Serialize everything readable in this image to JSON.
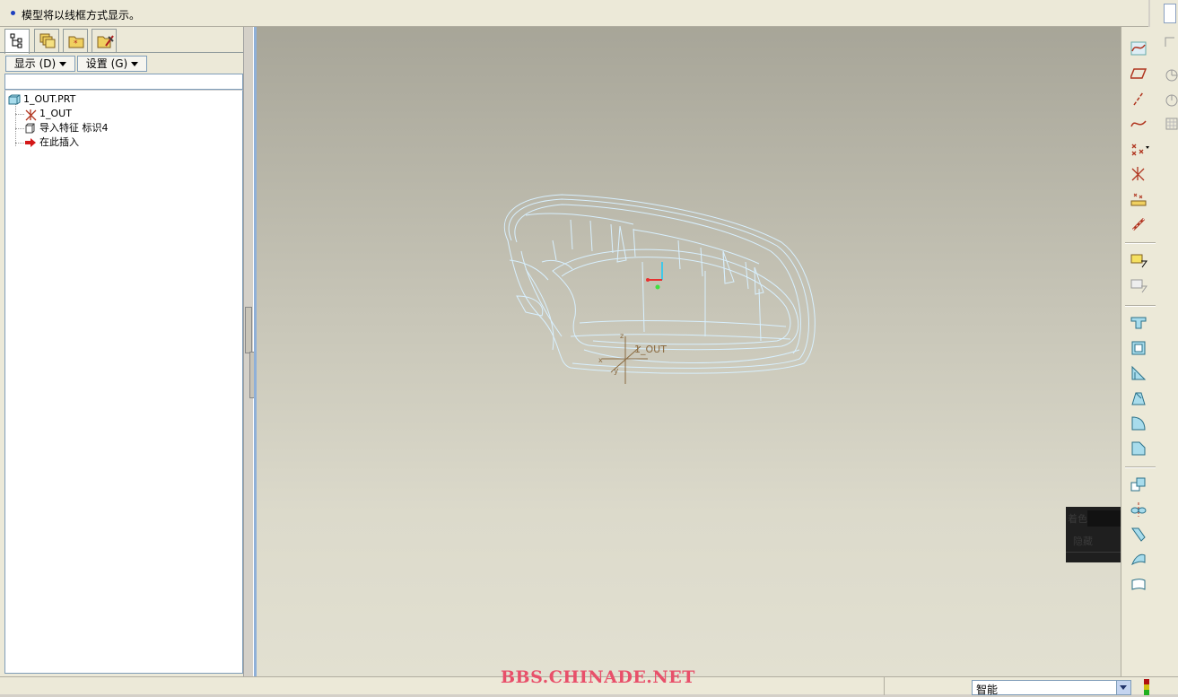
{
  "message": {
    "text": "模型将以线框方式显示。"
  },
  "left_panel": {
    "tabs": [
      {
        "icon": "model-tree-icon"
      },
      {
        "icon": "layers-icon"
      },
      {
        "icon": "favorites-folder-icon"
      },
      {
        "icon": "tools-icon"
      }
    ],
    "display_button": "显示 (D)",
    "settings_button": "设置 (G)",
    "filter_value": "",
    "tree": {
      "root": "1_OUT.PRT",
      "items": [
        {
          "label": "1_OUT",
          "icon": "coordinate-system-icon"
        },
        {
          "label": "导入特征 标识4",
          "icon": "import-feature-icon"
        },
        {
          "label": "在此插入",
          "icon": "insert-here-arrow-icon"
        }
      ]
    }
  },
  "viewport": {
    "csys_label": "1_OUT",
    "axis_labels": {
      "x": "x",
      "y": "y",
      "z": "z"
    }
  },
  "right_toolbar": {
    "buttons": [
      "sketch-curve-icon",
      "datum-plane-icon",
      "datum-axis-icon",
      "datum-curve-icon",
      "datum-point-icon",
      "coordinate-system-icon",
      "analysis-icon",
      "chain-icon",
      "annotation-icon",
      "annotation-alt-icon",
      "hole-icon",
      "shell-icon",
      "rib-icon",
      "draft-icon",
      "round-icon",
      "chamfer-icon",
      "copy-icon",
      "mirror-icon",
      "merge-icon",
      "trim-icon",
      "extend-icon"
    ],
    "secondary": [
      "edge-icon",
      "pie-icon",
      "pie-alt-icon",
      "grid-icon"
    ]
  },
  "overlay": {
    "line1": "着色",
    "line2": "隐藏"
  },
  "status": {
    "watermark": "BBS.CHINADE.NET",
    "filter_value": "智能"
  },
  "colors": {
    "wireframe": "#d8f0ff",
    "csys": "#8a6a40",
    "icon_red": "#b0341e",
    "icon_blue": "#2a8fa8"
  }
}
